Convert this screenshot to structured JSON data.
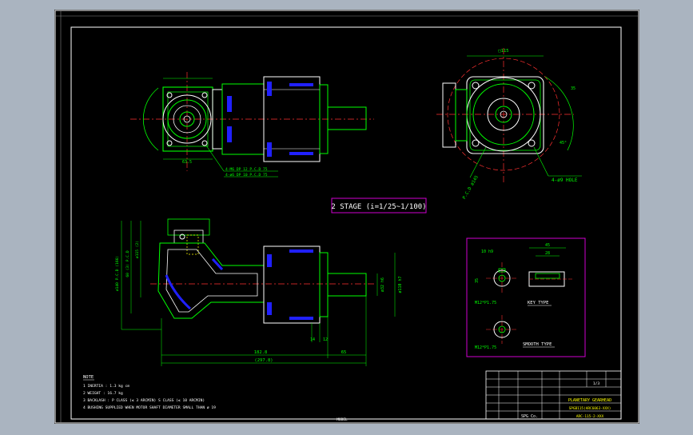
{
  "stage_box": {
    "text": "2 STAGE (i=1/25~1/100)"
  },
  "notes": {
    "title": "NOTE",
    "lines": [
      "1  INERTIA : 1.3 kg cm",
      "2  WEIGHT : 16.7 kg",
      "3  BACKLASH : P CLASS (≤ 3 ARCMIN) S CLASS (≤ 10 ARCMIN)",
      "4  BUSHING SUPPLIED WHEN MOTOR SHAFT DIAMETER SMALL THAN ø 19"
    ]
  },
  "front_view": {
    "square": "□115",
    "angle": "45°",
    "pcd": "P.C.D ø145",
    "hole": "4-ø9 HOLE",
    "dim_side": "35"
  },
  "top_view": {
    "tapped_holes_1": "4-M6 DP 12 P.C.D 75",
    "tapped_holes_2": "4-ø6 DP 10 P.C.D 75",
    "dim_small": "63.5"
  },
  "side_view": {
    "dim_total": "(297.8)",
    "dim_body": "182.8",
    "dim_shaft": "65",
    "dim_a": "14",
    "dim_b": "12",
    "dia_1": "ø32 h6",
    "dia_2": "ø110 h7",
    "left_dims": [
      "ø140 P.C.D (166)",
      "60 (3) P.C.D",
      "ø115 (2)"
    ]
  },
  "shaft_detail": {
    "key_title": "KEY TYPE",
    "smooth_title": "SMOOTH TYPE",
    "key_width": "10 h9",
    "tap_1": "M12*P1.75",
    "tap_2": "M12*P1.75",
    "dim_45": "45",
    "dim_28": "28",
    "dim_35": "35"
  },
  "title_block": {
    "company": "SPG  Co.",
    "product": "PLANETARY GEARHEAD",
    "model": "SPGB115(ARC6063-XXX)",
    "drawing_no": "ARC-115-2-XXX",
    "scale": "1/3"
  },
  "bottom_text": "MODEL"
}
